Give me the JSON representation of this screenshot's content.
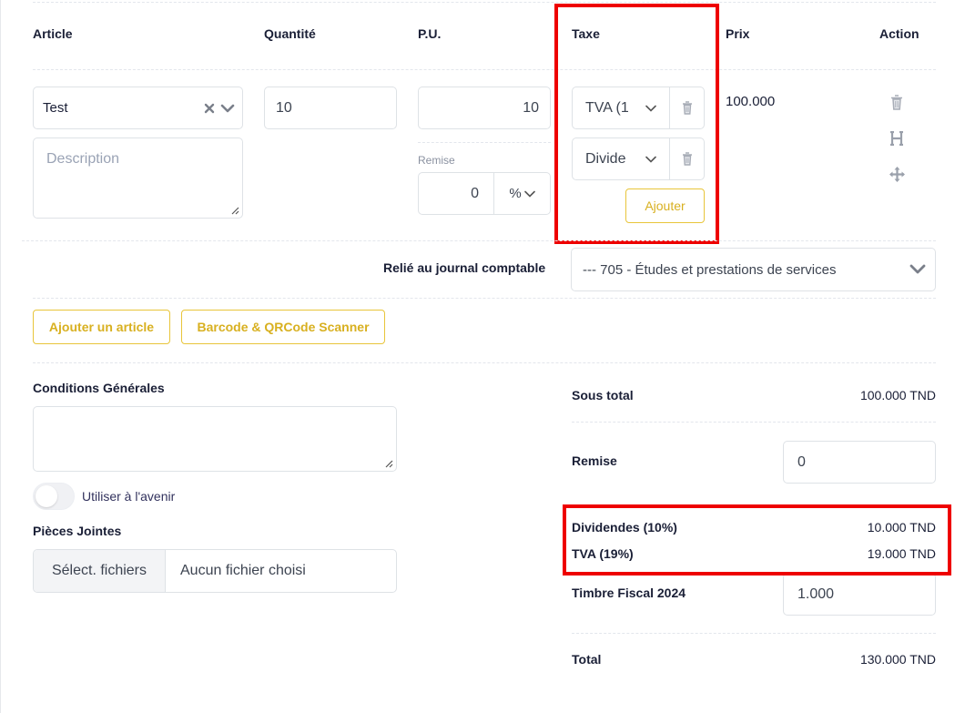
{
  "table": {
    "headers": {
      "article": "Article",
      "quantite": "Quantité",
      "pu": "P.U.",
      "taxe": "Taxe",
      "prix": "Prix",
      "action": "Action"
    },
    "row": {
      "article_value": "Test",
      "description_placeholder": "Description",
      "quantite_value": "10",
      "pu_value": "10",
      "remise_label": "Remise",
      "remise_value": "0",
      "remise_unit": "%",
      "taxes": [
        {
          "label": "TVA (1"
        },
        {
          "label": "Divide"
        }
      ],
      "ajouter_label": "Ajouter",
      "prix_value": "100.000"
    }
  },
  "journal": {
    "label": "Relié au journal comptable",
    "value": "--- 705 - Études et prestations de services"
  },
  "buttons": {
    "ajouter_article": "Ajouter un article",
    "scanner": "Barcode & QRCode Scanner"
  },
  "conditions": {
    "title": "Conditions Générales",
    "toggle_label": "Utiliser à l'avenir"
  },
  "pieces": {
    "title": "Pièces Jointes",
    "select_button": "Sélect. fichiers",
    "no_file": "Aucun fichier choisi"
  },
  "totals": {
    "sous_total_label": "Sous total",
    "sous_total_value": "100.000 TND",
    "remise_label": "Remise",
    "remise_value": "0",
    "dividendes_label": "Dividendes (10%)",
    "dividendes_value": "10.000 TND",
    "tva_label": "TVA (19%)",
    "tva_value": "19.000 TND",
    "timbre_label": "Timbre Fiscal 2024",
    "timbre_value": "1.000",
    "total_label": "Total",
    "total_value": "130.000 TND"
  },
  "colors": {
    "accent_yellow": "#d8b020",
    "highlight_red": "#ee0000"
  }
}
